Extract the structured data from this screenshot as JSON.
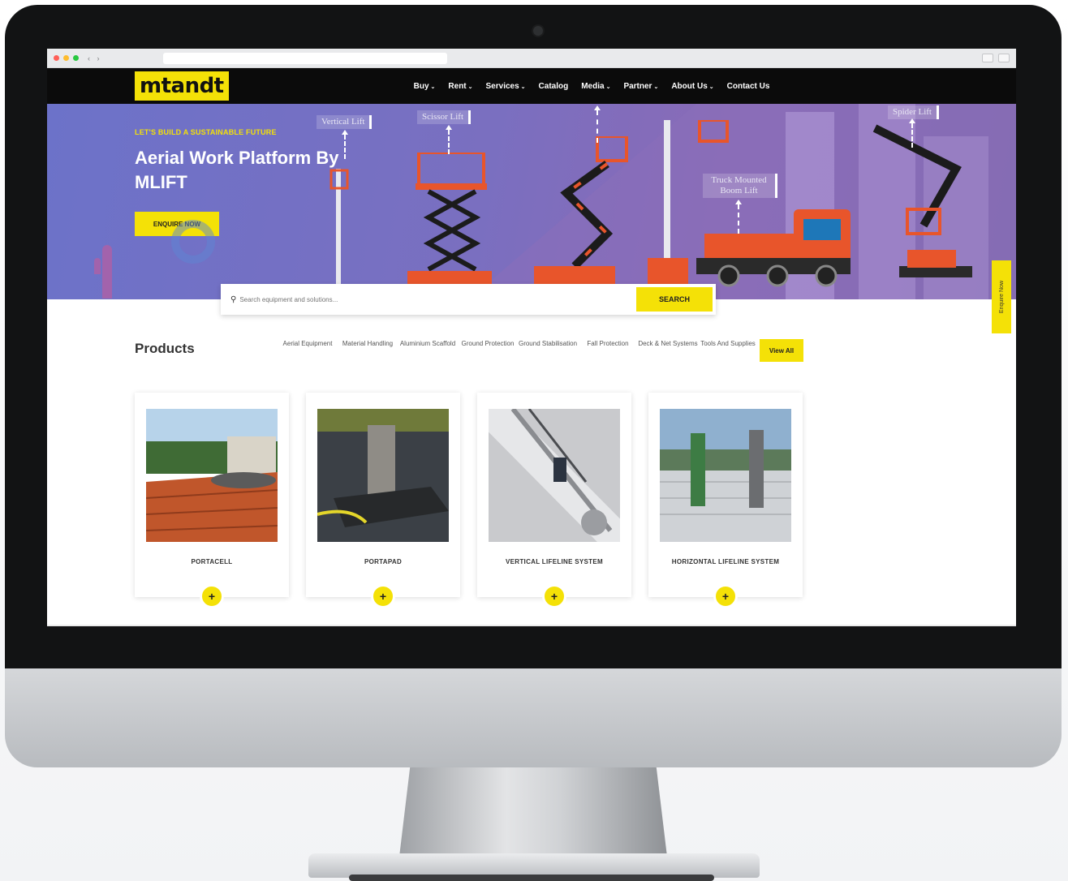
{
  "browser": {
    "nav_arrows": "‹ ›"
  },
  "header": {
    "logo": "mtandt",
    "nav": [
      {
        "label": "Buy",
        "has_dropdown": true
      },
      {
        "label": "Rent",
        "has_dropdown": true
      },
      {
        "label": "Services",
        "has_dropdown": true
      },
      {
        "label": "Catalog",
        "has_dropdown": false
      },
      {
        "label": "Media",
        "has_dropdown": true
      },
      {
        "label": "Partner",
        "has_dropdown": true
      },
      {
        "label": "About Us",
        "has_dropdown": true
      },
      {
        "label": "Contact Us",
        "has_dropdown": false
      }
    ]
  },
  "hero": {
    "tagline": "LET'S BUILD A SUSTAINABLE FUTURE",
    "title": "Aerial Work Platform By MLIFT",
    "cta": "ENQUIRE NOW",
    "labels": {
      "vertical": "Vertical Lift",
      "scissor": "Scissor Lift",
      "truck": "Truck Mounted Boom Lift",
      "spider": "Spider Lift"
    }
  },
  "search": {
    "placeholder": "Search equipment and solutions...",
    "button": "SEARCH"
  },
  "side_tab": "Enquire Now",
  "products": {
    "title": "Products",
    "categories": [
      "Aerial Equipment",
      "Material Handling",
      "Aluminium Scaffold",
      "Ground Protection",
      "Ground Stabilisation",
      "Fall Protection",
      "Deck & Net Systems",
      "Tools And Supplies"
    ],
    "view_all": "View All",
    "items": [
      {
        "name": "PORTACELL"
      },
      {
        "name": "PORTAPAD"
      },
      {
        "name": "VERTICAL LIFELINE SYSTEM"
      },
      {
        "name": "HORIZONTAL LIFELINE SYSTEM"
      }
    ]
  },
  "colors": {
    "accent": "#f4e107",
    "header_bg": "#0b0b0b",
    "hero_bg": "#7a6fc0",
    "machine_orange": "#e8552b"
  }
}
